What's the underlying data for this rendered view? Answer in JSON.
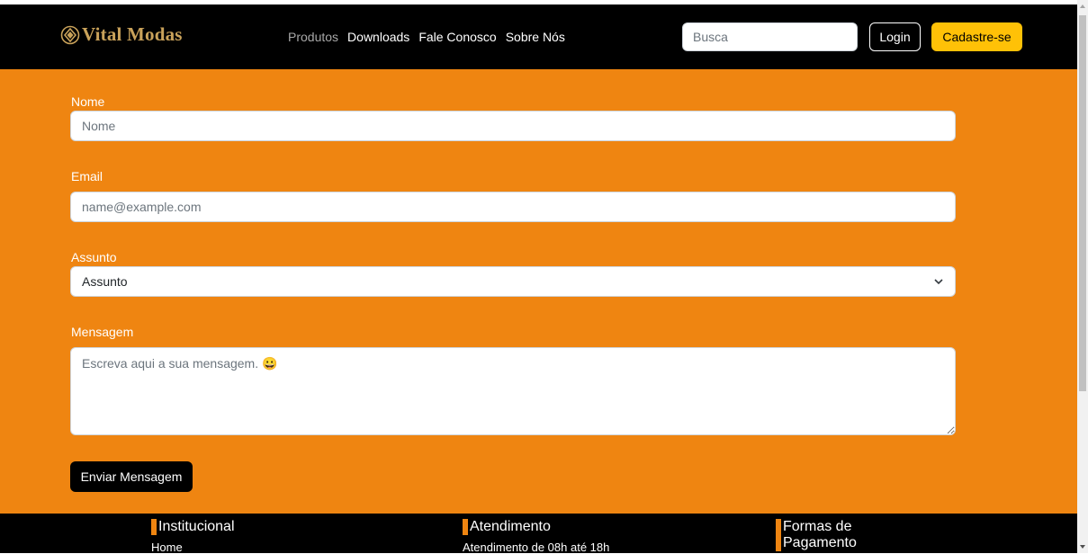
{
  "header": {
    "brand": "Vital Modas",
    "brand_icon": "diamond-icon",
    "nav": [
      {
        "label": "Produtos",
        "state": "muted"
      },
      {
        "label": "Downloads"
      },
      {
        "label": "Fale Conosco"
      },
      {
        "label": "Sobre Nós"
      }
    ],
    "search": {
      "placeholder": "Busca",
      "value": ""
    },
    "login_label": "Login",
    "signup_label": "Cadastre-se"
  },
  "form": {
    "name": {
      "label": "Nome",
      "placeholder": "Nome"
    },
    "email": {
      "label": "Email",
      "placeholder": "name@example.com"
    },
    "subject": {
      "label": "Assunto",
      "selected": "Assunto"
    },
    "message": {
      "label": "Mensagem",
      "placeholder": "Escreva aqui a sua mensagem. 😀"
    },
    "submit_label": "Enviar Mensagem"
  },
  "footer": {
    "columns": [
      {
        "title": "Institucional",
        "item": "Home"
      },
      {
        "title": "Atendimento",
        "item": "Atendimento de 08h até 18h"
      },
      {
        "title": "Formas de Pagamento",
        "item": ""
      }
    ]
  },
  "colors": {
    "navbar": "#000000",
    "brand": "#c9a25a",
    "form_background": "#ef8511",
    "signup_button": "#ffc107",
    "footer": "#000000"
  }
}
